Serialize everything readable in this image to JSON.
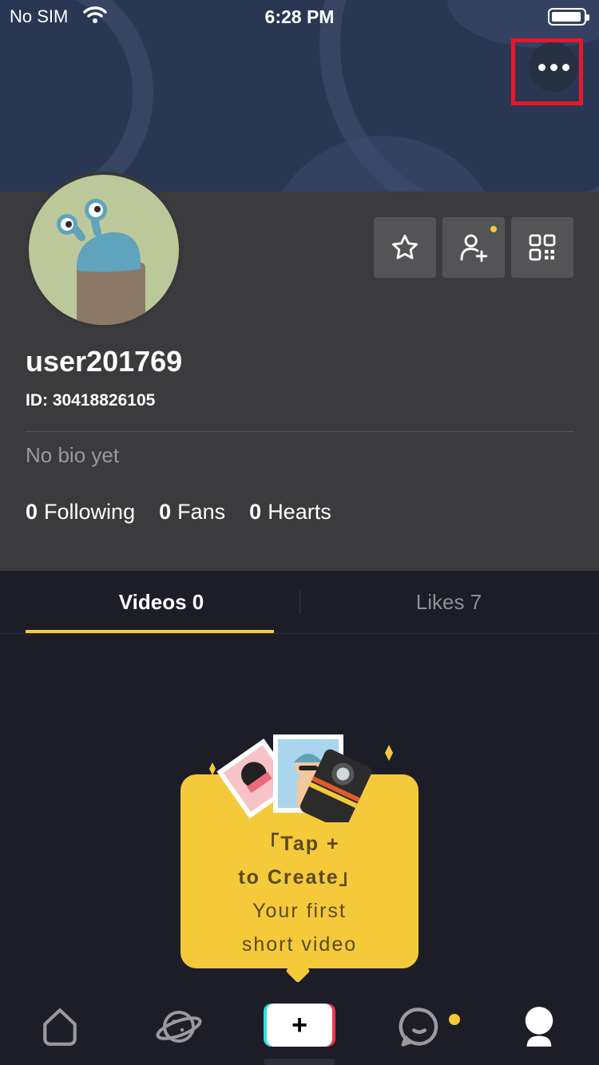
{
  "status_bar": {
    "carrier": "No SIM",
    "time": "6:28 PM"
  },
  "profile": {
    "username": "user201769",
    "id_label": "ID: 30418826105",
    "bio": "No bio yet",
    "stats": [
      {
        "value": "0",
        "label": "Following"
      },
      {
        "value": "0",
        "label": "Fans"
      },
      {
        "value": "0",
        "label": "Hearts"
      }
    ]
  },
  "tabs": [
    {
      "label": "Videos 0",
      "active": true
    },
    {
      "label": "Likes 7",
      "active": false
    }
  ],
  "create_card": {
    "line1": "「Tap +",
    "line2": "to Create」",
    "line3": "Your first",
    "line4": "short video"
  },
  "nav": {
    "create_symbol": "+",
    "items": [
      "home-icon",
      "discover-icon",
      "create-button",
      "messages-icon",
      "profile-icon"
    ]
  },
  "colors": {
    "accent": "#f4c93a",
    "highlight": "#e8172c",
    "background": "#1c1d27",
    "profile_bg": "#3b3b3d"
  }
}
